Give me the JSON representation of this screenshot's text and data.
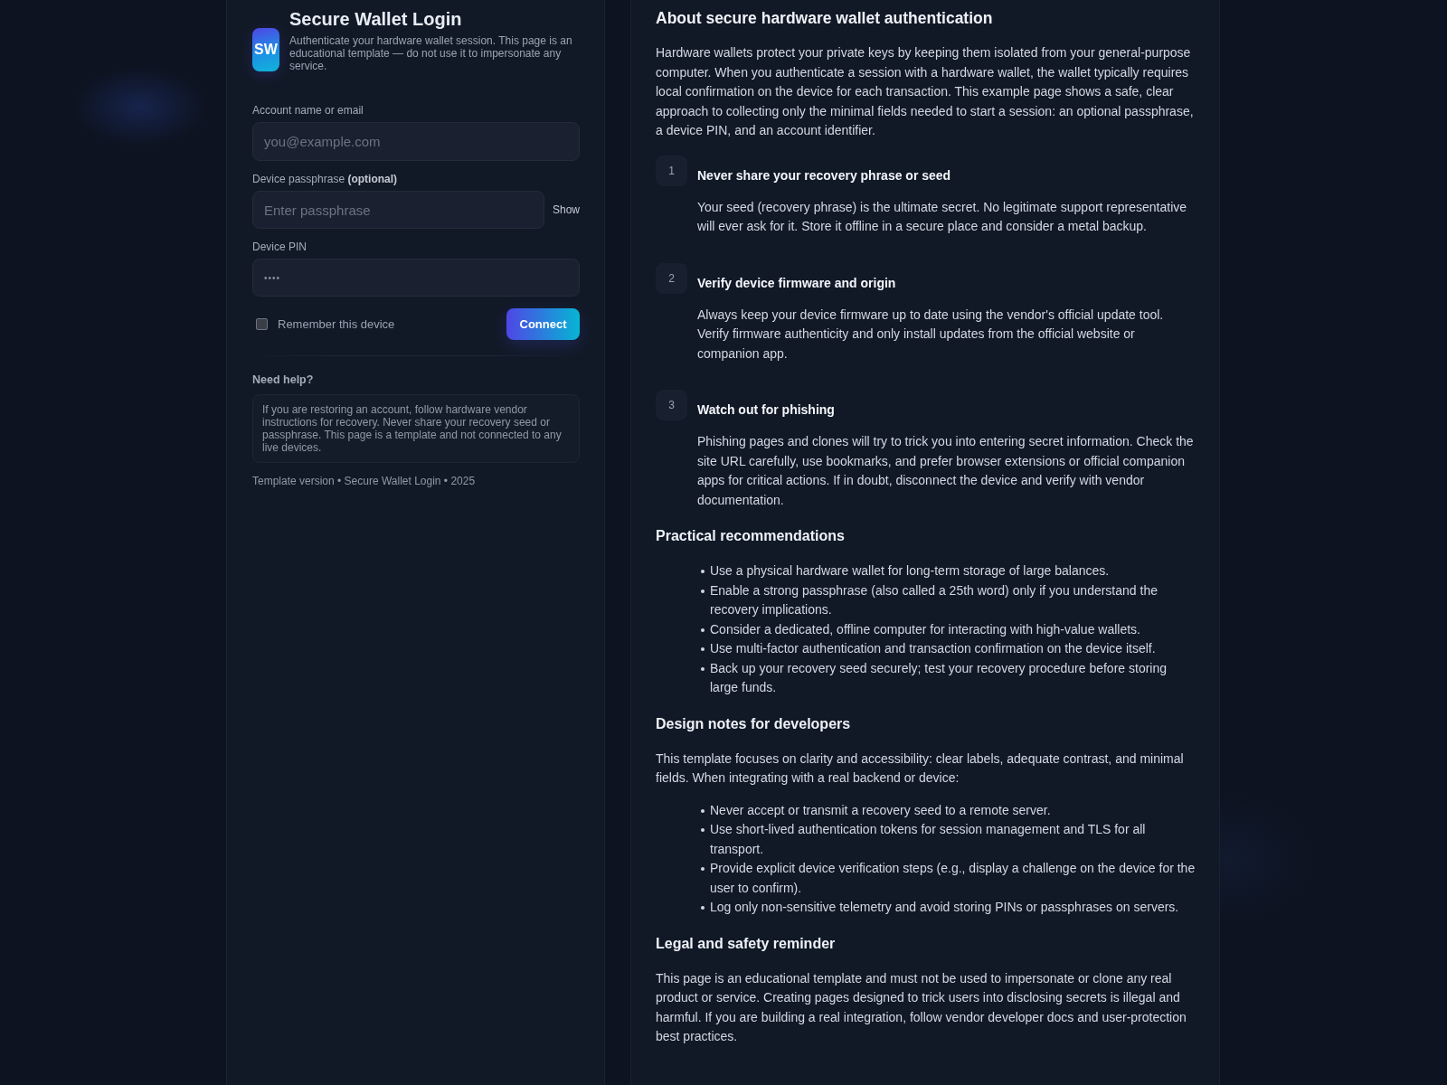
{
  "login_panel": {
    "logo": {
      "text": "SW"
    },
    "title": "Secure Wallet Login",
    "subtitle": "Authenticate your hardware wallet session. This page is an educational template — do not use it to impersonate any service.",
    "fields": [
      {
        "kind": "text",
        "label": "Account name or email",
        "placeholder": "you@example.com"
      },
      {
        "kind": "passphrase",
        "label": "Device passphrase **(optional)**",
        "placeholder": "Enter passphrase",
        "toggle": "Show"
      },
      {
        "kind": "pin",
        "label": "Device PIN",
        "value": "••••"
      }
    ],
    "remember": {
      "label": "Remember this device",
      "checked": false
    },
    "connect_button": "Connect",
    "help": {
      "title": "Need help?",
      "text": "If you are restoring an account, follow hardware vendor instructions for recovery. Never share your recovery seed or passphrase. This page is a template and not connected to any live devices."
    },
    "footer": "Template version • Secure Wallet Login • 2025"
  },
  "info_panel": {
    "heading": "About secure hardware wallet authentication",
    "intro": "Hardware wallets protect your private keys by keeping them isolated from your general-purpose computer. When you authenticate a session with a hardware wallet, the wallet typically requires local confirmation on the device for each transaction. This example page shows a safe, clear approach to collecting only the minimal fields needed to start a session: an optional passphrase, a device PIN, and an account identifier.",
    "steps": [
      {
        "number": "1",
        "title": "Never share your recovery phrase or seed",
        "text": "Your seed (recovery phrase) is the ultimate secret. No legitimate support representative will ever ask for it. Store it offline in a secure place and consider a metal backup."
      },
      {
        "number": "2",
        "title": "Verify device firmware and origin",
        "text": "Always keep your device firmware up to date using the vendor's official update tool. Verify firmware authenticity and only install updates from the official website or companion app."
      },
      {
        "number": "3",
        "title": "Watch out for phishing",
        "text": "Phishing pages and clones will try to trick you into entering secret information. Check the site URL carefully, use bookmarks, and prefer browser extensions or official companion apps for critical actions. If in doubt, disconnect the device and verify with vendor documentation."
      }
    ],
    "sections": [
      {
        "kind": "list",
        "heading": "Practical recommendations",
        "items": [
          "Use a physical hardware wallet for long-term storage of large balances.",
          "Enable a strong passphrase (also called a 25th word) only if you understand the recovery implications.",
          "Consider a dedicated, offline computer for interacting with high-value wallets.",
          "Use multi-factor authentication and transaction confirmation on the device itself.",
          "Back up your recovery seed securely; test your recovery procedure before storing large funds."
        ]
      },
      {
        "kind": "list",
        "heading": "Design notes for developers",
        "intro": "This template focuses on clarity and accessibility: clear labels, adequate contrast, and minimal fields. When integrating with a real backend or device:",
        "items": [
          "Never accept or transmit a recovery seed to a remote server.",
          "Use short-lived authentication tokens for session management and TLS for all transport.",
          "Provide explicit device verification steps (e.g., display a challenge on the device for the user to confirm).",
          "Log only non-sensitive telemetry and avoid storing PINs or passphrases on servers."
        ]
      },
      {
        "kind": "paragraph",
        "heading": "Legal and safety reminder",
        "text": "This page is an educational template and must not be used to impersonate or clone any real product or service. Creating pages designed to trick users into disclosing secrets is illegal and harmful. If you are building a real integration, follow vendor developer docs and user-protection best practices."
      }
    ]
  }
}
